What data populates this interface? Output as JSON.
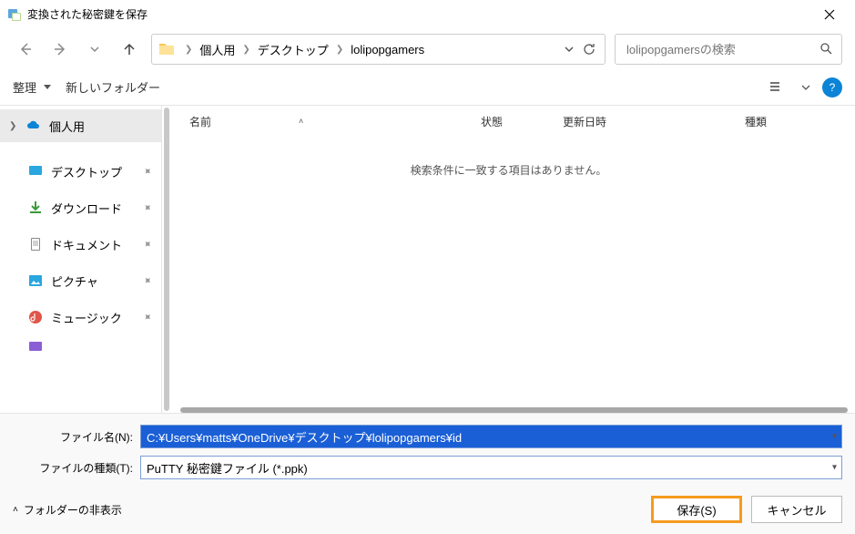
{
  "titlebar": {
    "title": "変換された秘密鍵を保存"
  },
  "breadcrumb": {
    "items": [
      "個人用",
      "デスクトップ",
      "lolipopgamers"
    ]
  },
  "search": {
    "placeholder": "lolipopgamersの検索"
  },
  "toolbar": {
    "organize": "整理",
    "newfolder": "新しいフォルダー"
  },
  "sidebar": {
    "root": "個人用",
    "items": [
      "デスクトップ",
      "ダウンロード",
      "ドキュメント",
      "ピクチャ",
      "ミュージック"
    ]
  },
  "columns": {
    "name": "名前",
    "state": "状態",
    "date": "更新日時",
    "type": "種類"
  },
  "empty": "検索条件に一致する項目はありません。",
  "filename_label": "ファイル名(N):",
  "filetype_label": "ファイルの種類(T):",
  "filename_value": "C:¥Users¥matts¥OneDrive¥デスクトップ¥lolipopgamers¥id",
  "filetype_value": "PuTTY 秘密鍵ファイル (*.ppk)",
  "hide_folders": "フォルダーの非表示",
  "save_btn": "保存(S)",
  "cancel_btn": "キャンセル"
}
